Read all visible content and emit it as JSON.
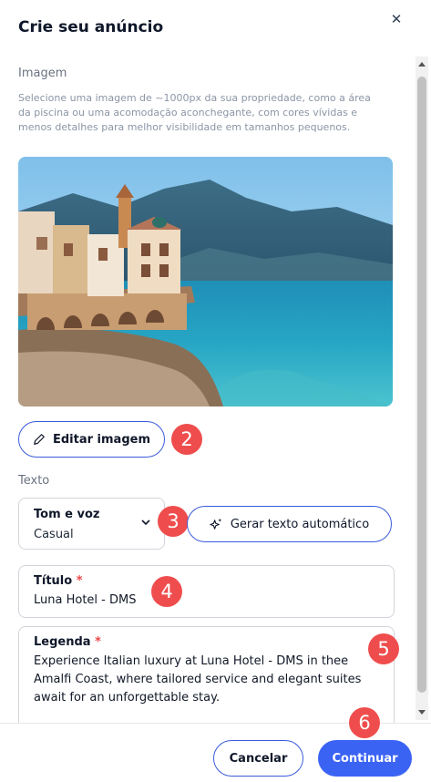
{
  "modal": {
    "title": "Crie seu anúncio",
    "close_icon": "close-icon"
  },
  "image_section": {
    "label": "Imagem",
    "description": "Selecione uma imagem de ~1000px da sua propriedade, como a área da piscina ou uma acomodação aconchegante, com cores vívidas e menos detalhes para melhor visibilidade em tamanhos pequenos.",
    "photo_alt": "Coastal town with colorful buildings, sea and mountains",
    "edit_button": "Editar imagem",
    "edit_icon": "pencil-icon"
  },
  "text_section": {
    "label": "Texto",
    "tone": {
      "label": "Tom e voz",
      "value": "Casual",
      "icon": "chevron-down-icon"
    },
    "generate_button": "Gerar texto automático",
    "generate_icon": "sparkles-icon",
    "title_field": {
      "label": "Título",
      "required_mark": "*",
      "value": "Luna Hotel - DMS"
    },
    "caption_field": {
      "label": "Legenda",
      "required_mark": "*",
      "value": "Experience Italian luxury at Luna Hotel - DMS in thee Amalfi Coast, where tailored service and elegant suites await for an unforgettable stay."
    }
  },
  "steps": [
    "2",
    "3",
    "4",
    "5",
    "6"
  ],
  "footer": {
    "cancel": "Cancelar",
    "continue": "Continuar"
  },
  "colors": {
    "accent": "#3b63f3",
    "outline": "#3b5bdb",
    "badge": "#ef4d4d",
    "required": "#ef4444"
  }
}
